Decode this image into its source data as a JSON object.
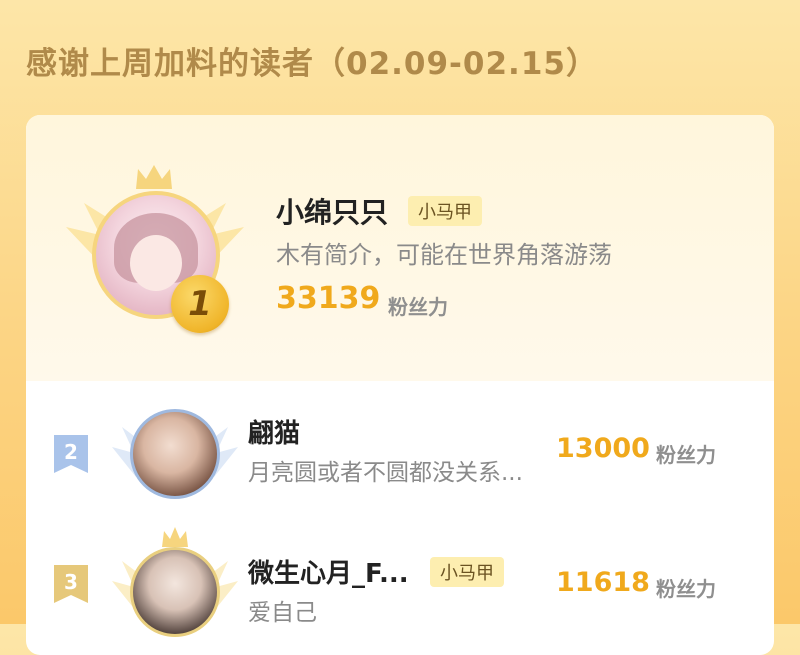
{
  "header": {
    "title": "感谢上周加料的读者（02.09-02.15）"
  },
  "top_reader": {
    "rank": "1",
    "name": "小绵只只",
    "tag": "小马甲",
    "bio": "木有简介，可能在世界角落游荡",
    "score": "33139",
    "unit": "粉丝力",
    "ring_color": "#f6d57e"
  },
  "readers": [
    {
      "rank": "2",
      "name": "翩猫",
      "tag": "",
      "bio": "月亮圆或者不圆都没关系...",
      "score": "13000",
      "unit": "粉丝力",
      "badge_color": "#a9c3ea"
    },
    {
      "rank": "3",
      "name": "微生心月_F...",
      "tag": "小马甲",
      "bio": "爱自己",
      "score": "11618",
      "unit": "粉丝力",
      "badge_color": "#e6c87a"
    }
  ],
  "colors": {
    "accent": "#f0a91c",
    "title": "#b08a4a",
    "background": "#fcd483"
  }
}
